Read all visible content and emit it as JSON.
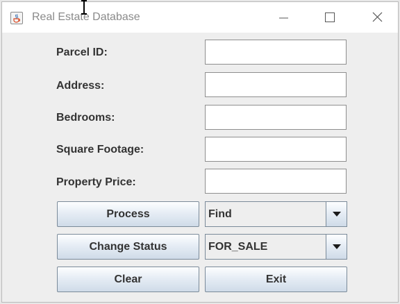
{
  "window": {
    "title": "Real Estate Database",
    "app_icon": "java-cup-icon",
    "controls": [
      "minimize-icon",
      "maximize-icon",
      "close-icon"
    ]
  },
  "form": {
    "fields": [
      {
        "label": "Parcel ID:",
        "value": ""
      },
      {
        "label": "Address:",
        "value": ""
      },
      {
        "label": "Bedrooms:",
        "value": ""
      },
      {
        "label": "Square Footage:",
        "value": ""
      },
      {
        "label": "Property Price:",
        "value": ""
      }
    ]
  },
  "actions": {
    "process_label": "Process",
    "process_mode_selected": "Find",
    "change_status_label": "Change Status",
    "status_selected": "FOR_SALE",
    "clear_label": "Clear",
    "exit_label": "Exit"
  },
  "colors": {
    "button_gradient_top": "#fdfeff",
    "button_gradient_bottom": "#cfdbe8",
    "button_border": "#7a8a99",
    "label_text": "#333333",
    "title_text": "#8a8a8a"
  }
}
